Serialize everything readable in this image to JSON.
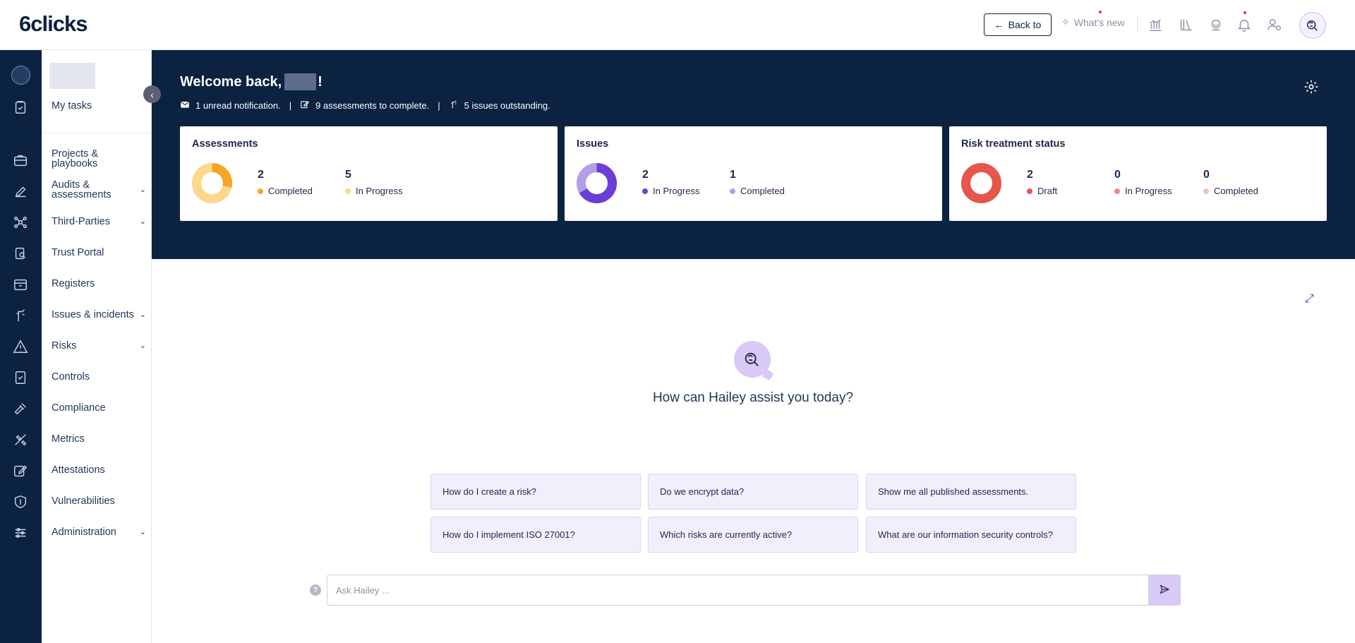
{
  "app": {
    "logo": "6clicks"
  },
  "topbar": {
    "back_label": "Back to",
    "whats_new_label": "What's new",
    "icons": [
      "chart-icon",
      "library-icon",
      "support-icon",
      "bell-icon",
      "user-settings-icon",
      "hailey-icon"
    ]
  },
  "sidebar": {
    "my_tasks": "My tasks",
    "items": [
      {
        "label": "Projects & playbooks",
        "icon": "briefcase-icon",
        "has_submenu": false
      },
      {
        "label": "Audits & assessments",
        "icon": "edit-icon",
        "has_submenu": true
      },
      {
        "label": "Third-Parties",
        "icon": "network-icon",
        "has_submenu": true
      },
      {
        "label": "Trust Portal",
        "icon": "trust-portal-icon",
        "has_submenu": false
      },
      {
        "label": "Registers",
        "icon": "register-icon",
        "has_submenu": false
      },
      {
        "label": "Issues & incidents",
        "icon": "issues-icon",
        "has_submenu": true
      },
      {
        "label": "Risks",
        "icon": "warning-icon",
        "has_submenu": true
      },
      {
        "label": "Controls",
        "icon": "controls-icon",
        "has_submenu": false
      },
      {
        "label": "Compliance",
        "icon": "gavel-icon",
        "has_submenu": false
      },
      {
        "label": "Metrics",
        "icon": "metrics-icon",
        "has_submenu": false
      },
      {
        "label": "Attestations",
        "icon": "attestation-icon",
        "has_submenu": false
      },
      {
        "label": "Vulnerabilities",
        "icon": "shield-icon",
        "has_submenu": false
      },
      {
        "label": "Administration",
        "icon": "sliders-icon",
        "has_submenu": true
      }
    ]
  },
  "hero": {
    "welcome_prefix": "Welcome back,",
    "welcome_suffix": "!",
    "notifications": "1 unread notification.",
    "assessments": "9 assessments to complete.",
    "issues": "5 issues outstanding.",
    "separator": "|"
  },
  "cards": {
    "assessments": {
      "title": "Assessments",
      "stats": [
        {
          "value": "2",
          "label": "Completed",
          "color": "#f5a623"
        },
        {
          "value": "5",
          "label": "In Progress",
          "color": "#fcd88a"
        }
      ]
    },
    "issues": {
      "title": "Issues",
      "stats": [
        {
          "value": "2",
          "label": "In Progress",
          "color": "#6b3fd6"
        },
        {
          "value": "1",
          "label": "Completed",
          "color": "#b49ee8"
        }
      ]
    },
    "risk": {
      "title": "Risk treatment status",
      "stats": [
        {
          "value": "2",
          "label": "Draft",
          "color": "#e5574a"
        },
        {
          "value": "0",
          "label": "In Progress",
          "color": "#ef8a80"
        },
        {
          "value": "0",
          "label": "Completed",
          "color": "#f6c1bb"
        }
      ]
    }
  },
  "assistant": {
    "title": "How can Hailey assist you today?",
    "suggestions": [
      "How do I create a risk?",
      "Do we encrypt data?",
      "Show me all published assessments.",
      "How do I implement ISO 27001?",
      "Which risks are currently active?",
      "What are our information security controls?"
    ],
    "input_placeholder": "Ask Hailey ...",
    "help_glyph": "?"
  }
}
